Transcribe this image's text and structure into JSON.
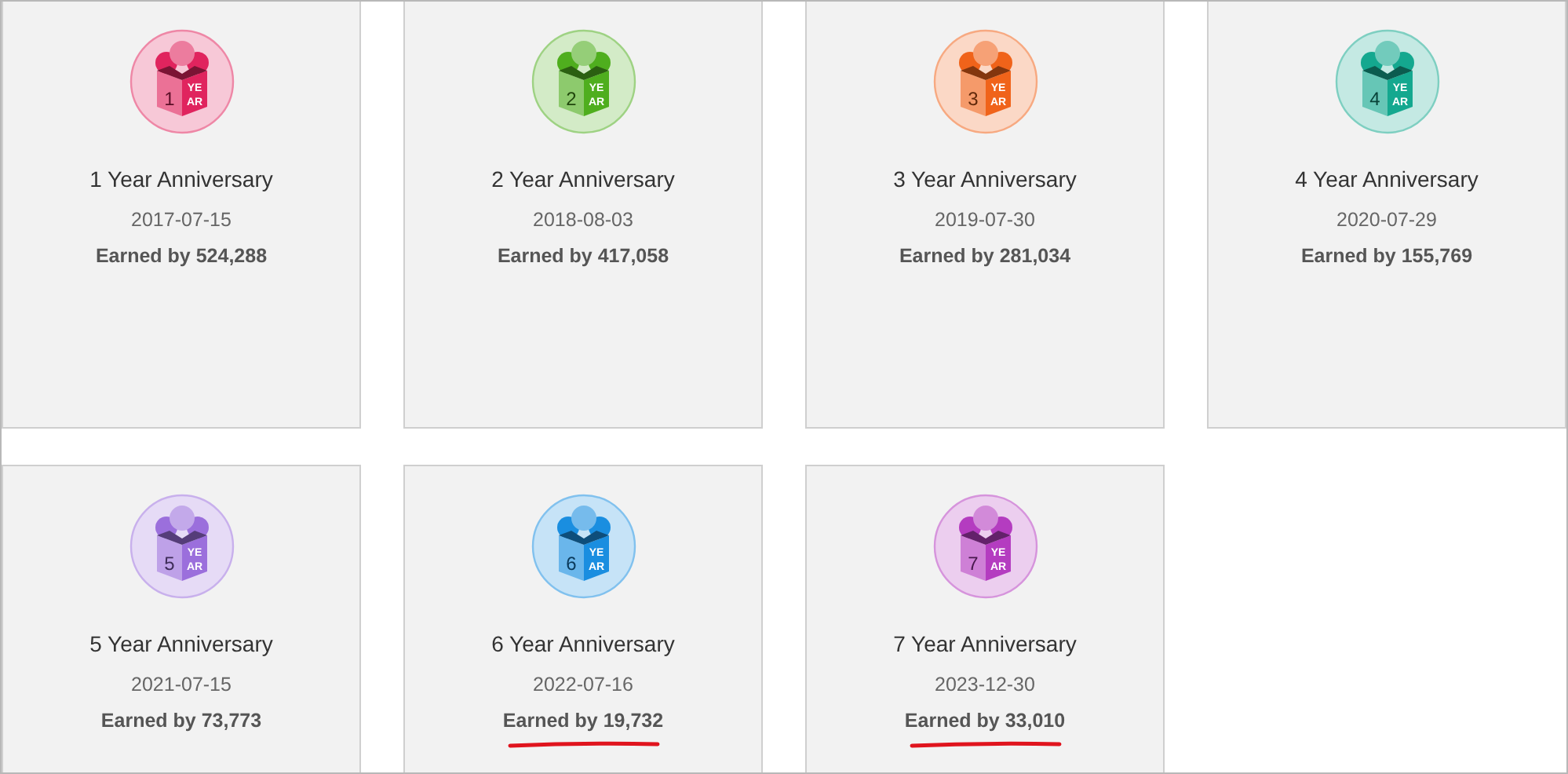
{
  "badges": [
    {
      "number": "1",
      "badge_top": "YE",
      "badge_bottom": "AR",
      "title": "1 Year Anniversary",
      "date": "2017-07-15",
      "earned": "Earned by 524,288",
      "color": "#e0245e",
      "underlined": false
    },
    {
      "number": "2",
      "badge_top": "YE",
      "badge_bottom": "AR",
      "title": "2 Year Anniversary",
      "date": "2018-08-03",
      "earned": "Earned by 417,058",
      "color": "#4fae1e",
      "underlined": false
    },
    {
      "number": "3",
      "badge_top": "YE",
      "badge_bottom": "AR",
      "title": "3 Year Anniversary",
      "date": "2019-07-30",
      "earned": "Earned by 281,034",
      "color": "#f0631a",
      "underlined": false
    },
    {
      "number": "4",
      "badge_top": "YE",
      "badge_bottom": "AR",
      "title": "4 Year Anniversary",
      "date": "2020-07-29",
      "earned": "Earned by 155,769",
      "color": "#14a88f",
      "underlined": false
    },
    {
      "number": "5",
      "badge_top": "YE",
      "badge_bottom": "AR",
      "title": "5 Year Anniversary",
      "date": "2021-07-15",
      "earned": "Earned by 73,773",
      "color": "#9b6fdc",
      "underlined": false
    },
    {
      "number": "6",
      "badge_top": "YE",
      "badge_bottom": "AR",
      "title": "6 Year Anniversary",
      "date": "2022-07-16",
      "earned": "Earned by 19,732",
      "color": "#1a8ee0",
      "underlined": true
    },
    {
      "number": "7",
      "badge_top": "YE",
      "badge_bottom": "AR",
      "title": "7 Year Anniversary",
      "date": "2023-12-30",
      "earned": "Earned by 33,010",
      "color": "#b43cc0",
      "underlined": true
    }
  ]
}
